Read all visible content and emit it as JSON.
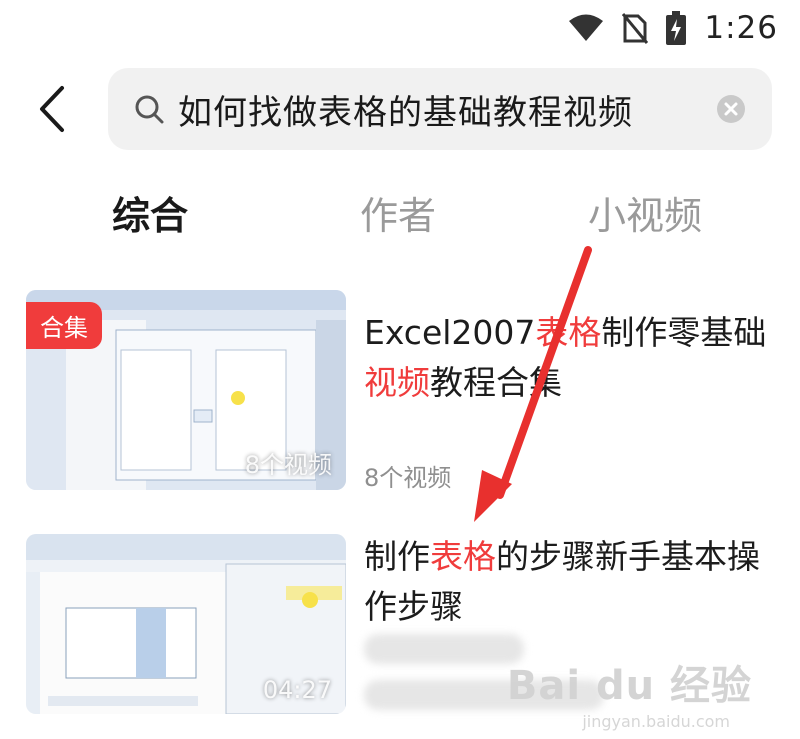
{
  "status_bar": {
    "time": "1:26",
    "icons": [
      "wifi-icon",
      "no-sim-icon",
      "battery-charging-icon"
    ]
  },
  "search": {
    "query": "如何找做表格的基础教程视频",
    "icons": [
      "back-icon",
      "search-icon",
      "clear-icon"
    ]
  },
  "tabs": [
    {
      "label": "综合",
      "active": true
    },
    {
      "label": "作者",
      "active": false
    },
    {
      "label": "小视频",
      "active": false
    }
  ],
  "results": [
    {
      "title_parts": [
        "Excel2007",
        "表格",
        "制作零基础",
        "视频",
        "教程合集"
      ],
      "badge": "合集",
      "thumb_overlay": "8个视频",
      "meta": "8个视频"
    },
    {
      "title_parts": [
        "制作",
        "表格",
        "的步骤新手基本操作步骤"
      ],
      "duration": "04:27"
    }
  ],
  "watermark": {
    "text": "Bai du 经验",
    "sub": "jingyan.baidu.com"
  },
  "colors": {
    "highlight": "#f03c3c",
    "search_bg": "#f1f1f1",
    "annotation_arrow": "#e8302e"
  }
}
